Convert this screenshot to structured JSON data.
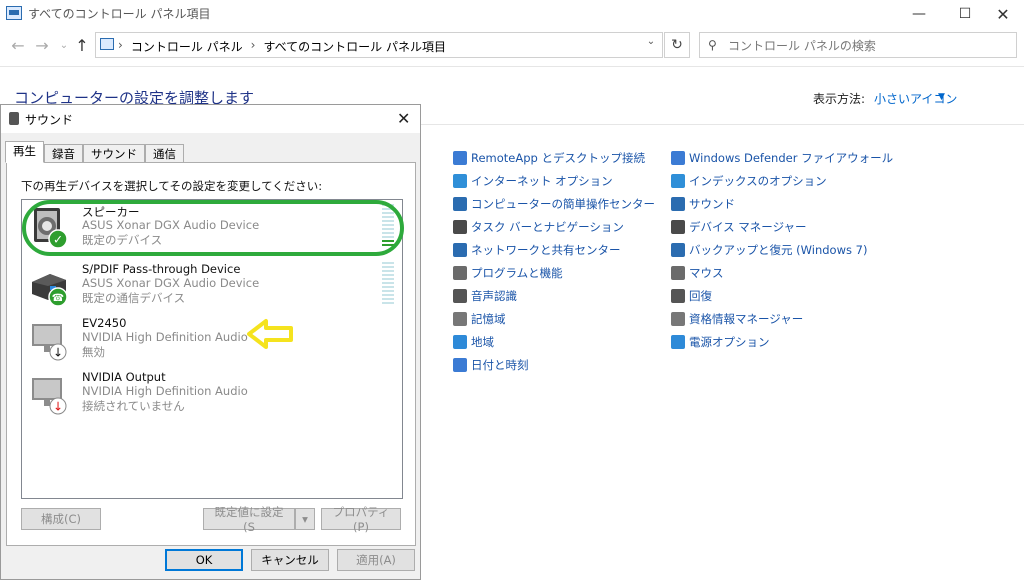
{
  "window": {
    "title": "すべてのコントロール パネル項目",
    "minimize": "—",
    "maximize": "☐",
    "close": "✕"
  },
  "navbar": {
    "breadcrumbs": [
      "コントロール パネル",
      "すべてのコントロール パネル項目"
    ],
    "search_placeholder": "コントロール パネルの検索"
  },
  "content": {
    "heading": "コンピューターの設定を調整します",
    "view_by_label": "表示方法:",
    "view_by_value": "小さいアイコン"
  },
  "cp_items": {
    "col1": [
      {
        "label": "RemoteApp とデスクトップ接続",
        "icon": "remote-desktop-icon"
      },
      {
        "label": "インターネット オプション",
        "icon": "internet-options-icon"
      },
      {
        "label": "コンピューターの簡単操作センター",
        "icon": "ease-of-access-icon"
      },
      {
        "label": "タスク バーとナビゲーション",
        "icon": "taskbar-icon"
      },
      {
        "label": "ネットワークと共有センター",
        "icon": "network-icon"
      },
      {
        "label": "プログラムと機能",
        "icon": "programs-icon"
      },
      {
        "label": "音声認識",
        "icon": "microphone-icon"
      },
      {
        "label": "記憶域",
        "icon": "storage-icon"
      },
      {
        "label": "地域",
        "icon": "region-icon"
      },
      {
        "label": "日付と時刻",
        "icon": "clock-icon"
      }
    ],
    "col2": [
      {
        "label": "Windows Defender ファイアウォール",
        "icon": "firewall-icon"
      },
      {
        "label": "インデックスのオプション",
        "icon": "indexing-icon"
      },
      {
        "label": "サウンド",
        "icon": "speaker-icon"
      },
      {
        "label": "デバイス マネージャー",
        "icon": "device-manager-icon"
      },
      {
        "label": "バックアップと復元 (Windows 7)",
        "icon": "backup-icon"
      },
      {
        "label": "マウス",
        "icon": "mouse-icon"
      },
      {
        "label": "回復",
        "icon": "recovery-icon"
      },
      {
        "label": "資格情報マネージャー",
        "icon": "credential-icon"
      },
      {
        "label": "電源オプション",
        "icon": "power-icon"
      }
    ]
  },
  "dialog": {
    "title": "サウンド",
    "close": "✕",
    "tabs": [
      "再生",
      "録音",
      "サウンド",
      "通信"
    ],
    "instruction": "下の再生デバイスを選択してその設定を変更してください:",
    "devices": [
      {
        "name": "スピーカー",
        "driver": "ASUS Xonar DGX Audio Device",
        "status": "既定のデバイス",
        "badge": "✓"
      },
      {
        "name": "S/PDIF Pass-through Device",
        "driver": "ASUS Xonar DGX Audio Device",
        "status": "既定の通信デバイス",
        "badge": "☎"
      },
      {
        "name": "EV2450",
        "driver": "NVIDIA High Definition Audio",
        "status": "無効",
        "badge": "↓"
      },
      {
        "name": "NVIDIA Output",
        "driver": "NVIDIA High Definition Audio",
        "status": "接続されていません",
        "badge": "↓"
      }
    ],
    "buttons": {
      "configure": "構成(C)",
      "set_default": "既定値に設定(S",
      "properties": "プロパティ(P)",
      "ok": "OK",
      "cancel": "キャンセル",
      "apply": "適用(A)"
    },
    "meter_level": 0.15
  },
  "colors": {
    "highlight_green": "#2eaa3c",
    "arrow_yellow": "#f5e31e",
    "link_blue": "#1a54a8",
    "heading_blue": "#1e3287"
  }
}
